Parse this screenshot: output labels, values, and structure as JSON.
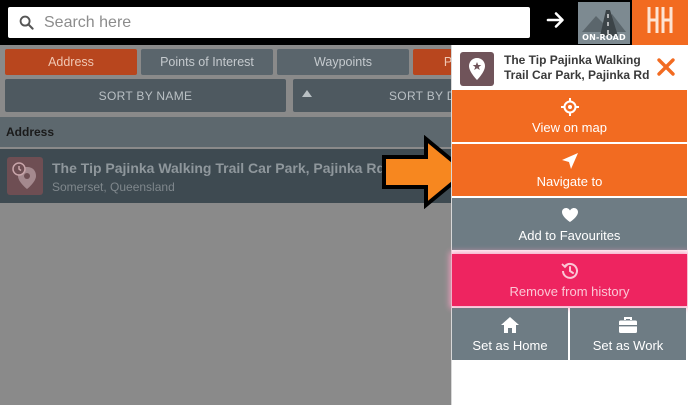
{
  "search": {
    "placeholder": "Search here"
  },
  "onroad_label": "ON-ROAD",
  "filters": [
    "Address",
    "Points of Interest",
    "Waypoints",
    "P"
  ],
  "sort": {
    "by_name": "SORT BY NAME",
    "by_distance": "SORT BY DI"
  },
  "section_header": "Address",
  "result": {
    "title": "The Tip Pajinka Walking Trail Car Park,  Pajinka Rd",
    "subtitle": "Somerset, Queensland"
  },
  "panel": {
    "title_line1": "The Tip Pajinka Walking",
    "title_line2": "Trail Car Park,  Pajinka Rd",
    "actions": {
      "view_on_map": "View on map",
      "navigate_to": "Navigate to",
      "add_to_favourites": "Add to Favourites",
      "remove_from_history": "Remove from history",
      "set_as_home": "Set as Home",
      "set_as_work": "Set as Work"
    }
  },
  "colors": {
    "accent": "#f26b21",
    "danger": "#ee2460",
    "slate": "#6e7c84"
  },
  "icons": [
    "search-icon",
    "arrow-right-icon",
    "on-road-icon",
    "logo-icon",
    "history-star-pin-icon",
    "location-pin-icon",
    "close-icon",
    "crosshair-icon",
    "navigate-arrow-icon",
    "heart-icon",
    "history-icon",
    "home-icon",
    "briefcase-icon",
    "pointer-arrow-icon"
  ]
}
